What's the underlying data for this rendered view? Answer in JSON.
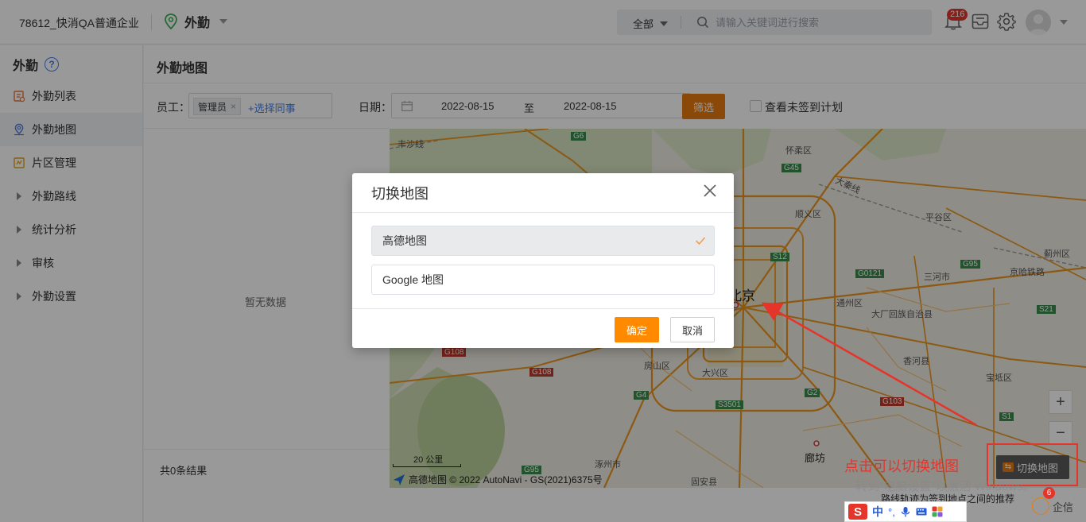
{
  "header": {
    "company": "78612_快消QA普通企业",
    "module": "外勤",
    "search_scope": "全部",
    "search_placeholder": "请输入关键词进行搜索",
    "notification_count": "216"
  },
  "sidebar": {
    "title": "外勤",
    "help": "?",
    "items": [
      {
        "label": "外勤列表",
        "icon": "list-icon"
      },
      {
        "label": "外勤地图",
        "icon": "map-pin-icon",
        "active": true
      },
      {
        "label": "片区管理",
        "icon": "area-icon"
      },
      {
        "label": "外勤路线",
        "icon": "expand-arrow-icon"
      },
      {
        "label": "统计分析",
        "icon": "expand-arrow-icon"
      },
      {
        "label": "审核",
        "icon": "expand-arrow-icon"
      },
      {
        "label": "外勤设置",
        "icon": "expand-arrow-icon"
      }
    ]
  },
  "main": {
    "title": "外勤地图",
    "filters": {
      "staff_label": "员工：",
      "staff_tag": "管理员",
      "tag_close": "×",
      "add_colleague": "+选择同事",
      "date_label": "日期：",
      "date_from": "2022-08-15",
      "date_to_word": "至",
      "date_to": "2022-08-15",
      "filter_button": "筛选",
      "unsigned_plan_label": "查看未签到计划"
    },
    "empty_text": "暂无数据",
    "result_count": "共0条结果",
    "footnote": "路线轨迹为签到地点之间的推荐"
  },
  "map": {
    "city_label": "北京",
    "place_labels": [
      "怀柔区",
      "顺义区",
      "平谷区",
      "蓟州区",
      "通州区",
      "三河市",
      "大厂回族自治县",
      "香河县",
      "宝坻区",
      "房山区",
      "大兴区",
      "廊坊",
      "涿州市",
      "固安县",
      "京哈铁路",
      "大秦线",
      "丰沙线"
    ],
    "road_shields": [
      "G6",
      "G45",
      "S12",
      "G0121",
      "G95",
      "S21",
      "G108",
      "G108",
      "G4",
      "S3501",
      "G2",
      "G103",
      "S1",
      "G95"
    ],
    "scale_label": "20 公里",
    "attribution": "高德地图 © 2022 AutoNavi - GS(2021)6375号",
    "zoom_in": "+",
    "zoom_out": "−",
    "switch_button": "切换地图"
  },
  "annotation": {
    "text": "点击可以切换地图",
    "color": "#e5352b"
  },
  "watermark": "转到\"电脑设置\"以激活 Windows。",
  "modal": {
    "title": "切换地图",
    "options": [
      {
        "label": "高德地图",
        "selected": true
      },
      {
        "label": "Google 地图",
        "selected": false
      }
    ],
    "confirm": "确定",
    "cancel": "取消"
  },
  "tray": {
    "ime_brand": "S",
    "ime_mode": "中",
    "ime_punct": "°,",
    "enterprise_label": "企信",
    "enterprise_badge": "6"
  },
  "colors": {
    "accent": "#e87a0f",
    "confirm": "#ff8a00",
    "link": "#3f7ef0",
    "badge": "#e5352b"
  }
}
